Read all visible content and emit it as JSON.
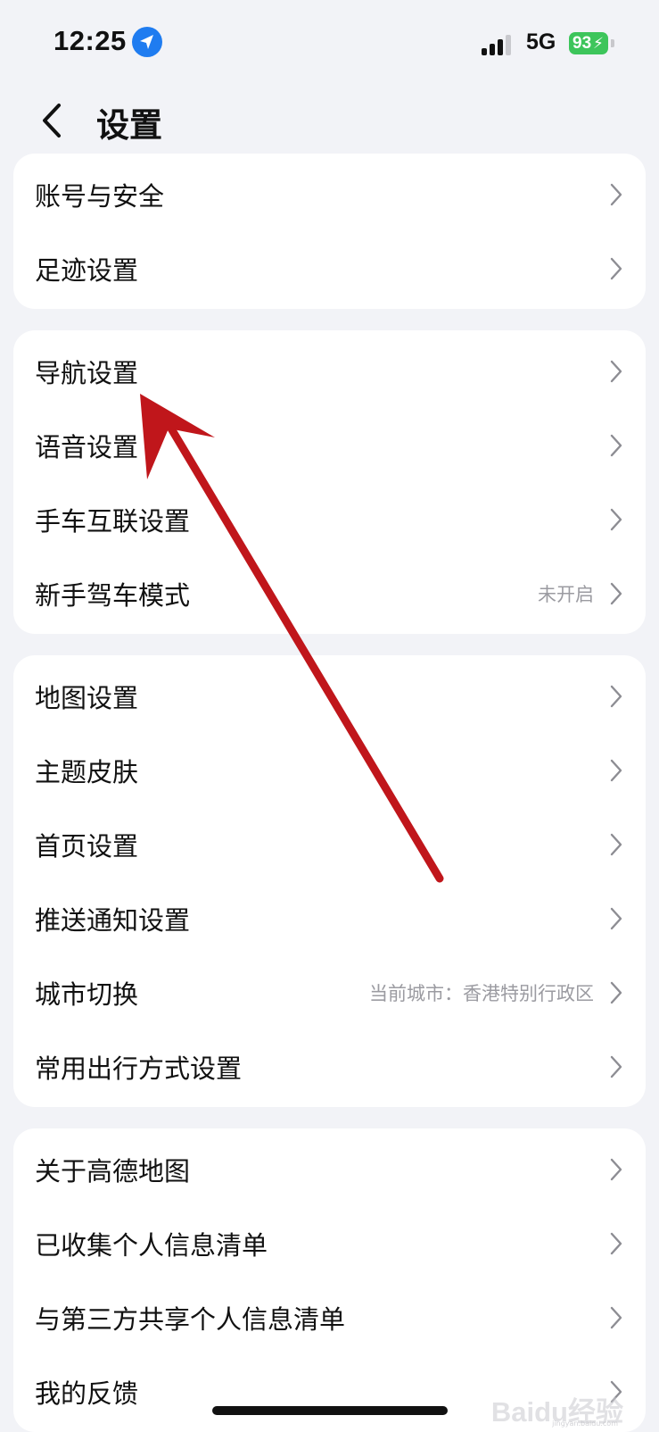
{
  "status_bar": {
    "time": "12:25",
    "network": "5G",
    "battery": "93",
    "icons": [
      "location-arrow-icon",
      "signal-bars-icon",
      "battery-charging-icon"
    ]
  },
  "nav": {
    "title": "设置",
    "back_icon": "chevron-left-icon"
  },
  "groups": [
    {
      "items": [
        {
          "label": "账号与安全",
          "value": ""
        },
        {
          "label": "足迹设置",
          "value": ""
        }
      ]
    },
    {
      "items": [
        {
          "label": "导航设置",
          "value": ""
        },
        {
          "label": "语音设置",
          "value": ""
        },
        {
          "label": "手车互联设置",
          "value": ""
        },
        {
          "label": "新手驾车模式",
          "value": "未开启"
        }
      ]
    },
    {
      "items": [
        {
          "label": "地图设置",
          "value": ""
        },
        {
          "label": "主题皮肤",
          "value": ""
        },
        {
          "label": "首页设置",
          "value": ""
        },
        {
          "label": "推送通知设置",
          "value": ""
        },
        {
          "label": "城市切换",
          "value": "当前城市：香港特别行政区"
        },
        {
          "label": "常用出行方式设置",
          "value": ""
        }
      ]
    },
    {
      "items": [
        {
          "label": "关于高德地图",
          "value": ""
        },
        {
          "label": "已收集个人信息清单",
          "value": ""
        },
        {
          "label": "与第三方共享个人信息清单",
          "value": ""
        },
        {
          "label": "我的反馈",
          "value": ""
        }
      ]
    }
  ],
  "watermark": {
    "logo": "Baidu经验",
    "url": "jingyan.baidu.com"
  },
  "colors": {
    "background": "#f2f3f7",
    "card": "#ffffff",
    "annotation_arrow": "#c0161b",
    "location_blue": "#1f7cf0",
    "battery_green": "#3dc55b"
  }
}
